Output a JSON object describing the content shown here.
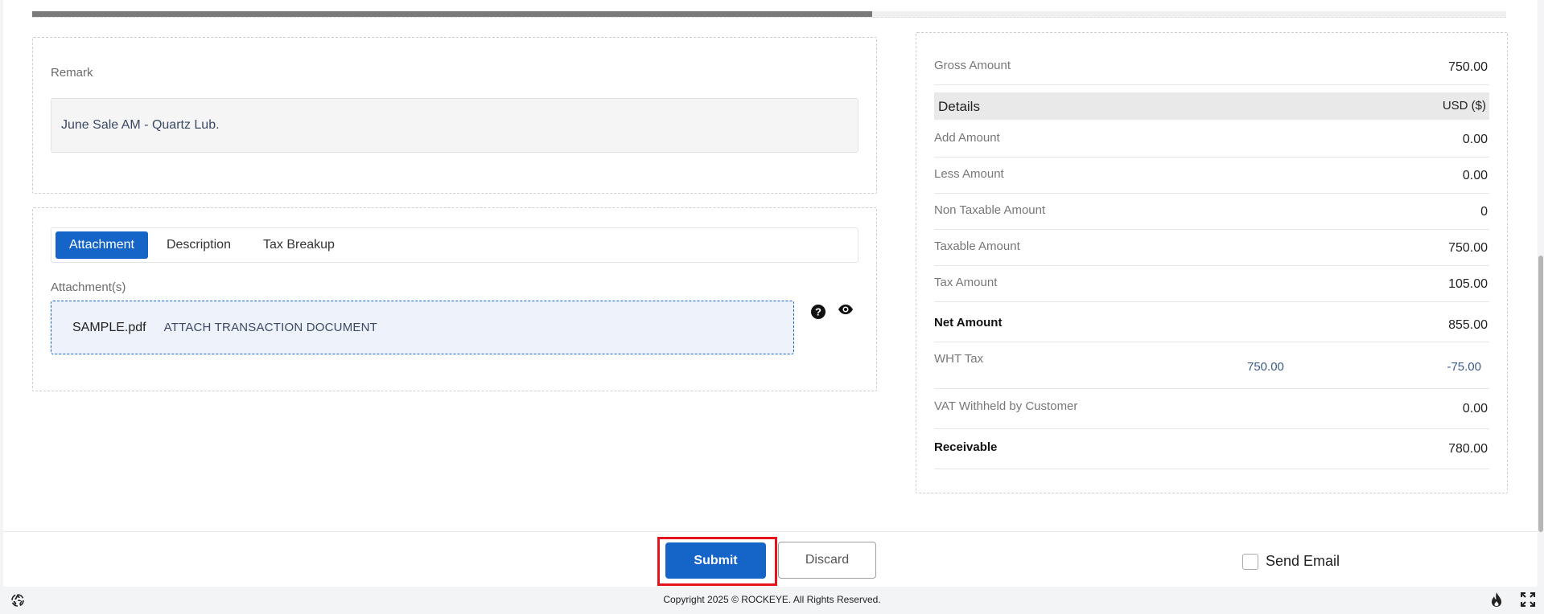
{
  "progress": {
    "fraction": 0.57
  },
  "remark": {
    "label": "Remark",
    "value": "June Sale AM - Quartz Lub."
  },
  "tabs": {
    "items": [
      {
        "label": "Attachment",
        "active": true
      },
      {
        "label": "Description",
        "active": false
      },
      {
        "label": "Tax Breakup",
        "active": false
      }
    ]
  },
  "attachments": {
    "label": "Attachment(s)",
    "file_name": "SAMPLE.pdf",
    "attach_prompt": "ATTACH TRANSACTION DOCUMENT",
    "help_icon": "help-icon",
    "view_icon": "eye-icon"
  },
  "summary": {
    "gross_amount": {
      "label": "Gross Amount",
      "value": "750.00"
    },
    "details": {
      "label": "Details",
      "currency": "USD ($)"
    },
    "add_amount": {
      "label": "Add Amount",
      "value": "0.00"
    },
    "less_amount": {
      "label": "Less Amount",
      "value": "0.00"
    },
    "non_taxable_amount": {
      "label": "Non Taxable Amount",
      "value": "0"
    },
    "taxable_amount": {
      "label": "Taxable Amount",
      "value": "750.00"
    },
    "tax_amount": {
      "label": "Tax Amount",
      "value": "105.00"
    },
    "net_amount": {
      "label": "Net Amount",
      "value": "855.00"
    },
    "wht_tax": {
      "label": "WHT Tax",
      "base": "750.00",
      "value": "-75.00"
    },
    "vat_withheld": {
      "label": "VAT Withheld by Customer",
      "value": "0.00"
    },
    "receivable": {
      "label": "Receivable",
      "value": "780.00"
    }
  },
  "actions": {
    "submit_label": "Submit",
    "discard_label": "Discard",
    "send_email_label": "Send Email",
    "send_email_checked": false
  },
  "footer": {
    "copyright": "Copyright 2025 © ROCKEYE. All Rights Reserved."
  },
  "colors": {
    "primary": "#1565c8",
    "highlight": "#e5141c"
  }
}
